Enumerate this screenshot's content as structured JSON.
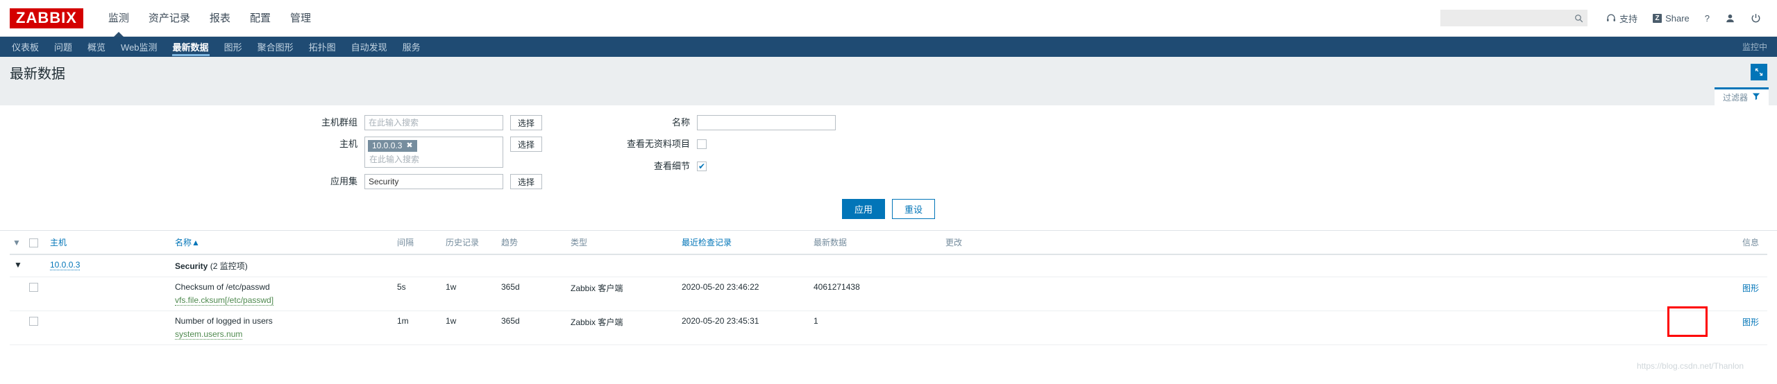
{
  "brand": {
    "logo": "ZABBIX"
  },
  "mainnav": {
    "items": [
      {
        "label": "监测",
        "selected": true
      },
      {
        "label": "资产记录",
        "selected": false
      },
      {
        "label": "报表",
        "selected": false
      },
      {
        "label": "配置",
        "selected": false
      },
      {
        "label": "管理",
        "selected": false
      }
    ]
  },
  "topright": {
    "search_placeholder": "",
    "search_value": "",
    "support_label": "支持",
    "share_label": "Share",
    "share_badge": "Z",
    "help_label": "?"
  },
  "subnav": {
    "items": [
      {
        "label": "仪表板",
        "selected": false
      },
      {
        "label": "问题",
        "selected": false
      },
      {
        "label": "概览",
        "selected": false
      },
      {
        "label": "Web监测",
        "selected": false
      },
      {
        "label": "最新数据",
        "selected": true
      },
      {
        "label": "图形",
        "selected": false
      },
      {
        "label": "聚合图形",
        "selected": false
      },
      {
        "label": "拓扑图",
        "selected": false
      },
      {
        "label": "自动发现",
        "selected": false
      },
      {
        "label": "服务",
        "selected": false
      }
    ],
    "right_label": "监控中"
  },
  "page": {
    "title": "最新数据"
  },
  "filter": {
    "tab_label": "过滤器",
    "hostgroup_label": "主机群组",
    "hostgroup_placeholder": "在此输入搜索",
    "hostgroup_value": "",
    "host_label": "主机",
    "host_chip": "10.0.0.3",
    "host_chip_remove": "✖",
    "host_placeholder": "在此输入搜索",
    "application_label": "应用集",
    "application_value": "Security",
    "select_label": "选择",
    "name_label": "名称",
    "name_value": "",
    "show_without_data_label": "查看无资料项目",
    "show_without_data_checked": false,
    "show_details_label": "查看细节",
    "show_details_checked": true,
    "apply_label": "应用",
    "reset_label": "重设"
  },
  "table": {
    "columns": [
      {
        "label": "主机",
        "link": true
      },
      {
        "label": "名称",
        "link": true,
        "sort": "▲"
      },
      {
        "label": "间隔",
        "link": false
      },
      {
        "label": "历史记录",
        "link": false
      },
      {
        "label": "趋势",
        "link": false
      },
      {
        "label": "类型",
        "link": false
      },
      {
        "label": "最近检查记录",
        "link": true
      },
      {
        "label": "最新数据",
        "link": false
      },
      {
        "label": "更改",
        "link": false
      },
      {
        "label": "信息",
        "link": false
      }
    ],
    "group_row": {
      "host": "10.0.0.3",
      "application": "Security",
      "application_count": "(2 监控项)"
    },
    "rows": [
      {
        "name": "Checksum of /etc/passwd",
        "key": "vfs.file.cksum[/etc/passwd]",
        "interval": "5s",
        "history": "1w",
        "trends": "365d",
        "type": "Zabbix 客户端",
        "last_check": "2020-05-20 23:46:22",
        "last_value": "4061271438",
        "change": "",
        "graph_label": "图形",
        "highlighted": true
      },
      {
        "name": "Number of logged in users",
        "key": "system.users.num",
        "interval": "1m",
        "history": "1w",
        "trends": "365d",
        "type": "Zabbix 客户端",
        "last_check": "2020-05-20 23:45:31",
        "last_value": "1",
        "change": "",
        "graph_label": "图形",
        "highlighted": false
      }
    ]
  },
  "watermark": {
    "text": "https://blog.csdn.net/Thanlon"
  },
  "colors": {
    "brand_red": "#d40000",
    "nav_blue": "#1f4b73",
    "accent": "#0275b8",
    "highlight": "#fe0000"
  }
}
